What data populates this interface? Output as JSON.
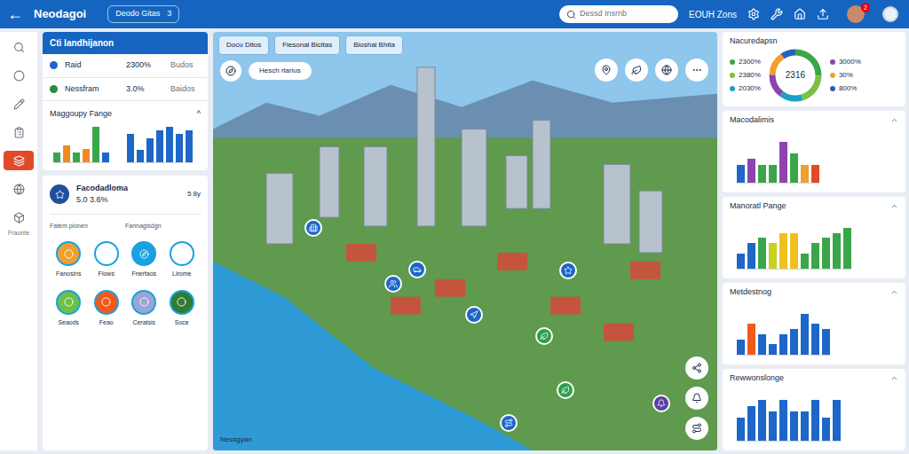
{
  "app": {
    "title": "Neodagoi",
    "back": "←"
  },
  "top_bar": {
    "pill": "Deodo Gitas",
    "pill_count": "3",
    "search": {
      "placeholder": "Dessd Insrnb"
    },
    "zone_label": "EOUH Zons",
    "badge": "2"
  },
  "rail": {
    "items": [
      {
        "selected": false
      },
      {
        "selected": false
      },
      {
        "selected": false
      },
      {
        "selected": false
      },
      {
        "selected": true
      },
      {
        "selected": false
      },
      {
        "selected": false
      }
    ],
    "caption": "Fraonte"
  },
  "left_panel": {
    "title": "Cti Iandhijanon",
    "stats": [
      {
        "name": "Raid",
        "value": "2300%",
        "note": "Budos",
        "color": "#1e66c8"
      },
      {
        "name": "Nessfram",
        "value": "3.0%",
        "note": "Baidos",
        "color": "#2e8b3e"
      }
    ],
    "chart": {
      "title": "Maggoupy Fange",
      "toggle": "^",
      "groups": [
        [
          {
            "value": 3,
            "color": "#3aa64a"
          },
          {
            "value": 5,
            "color": "#f08a24"
          },
          {
            "value": 3,
            "color": "#3aa64a"
          },
          {
            "value": 4,
            "color": "#f08a24"
          },
          {
            "value": 11,
            "color": "#3aa64a"
          },
          {
            "value": 3,
            "color": "#1e66c8"
          }
        ],
        [
          {
            "value": 7,
            "color": "#1e66c8"
          },
          {
            "value": 3,
            "color": "#1e66c8"
          },
          {
            "value": 6,
            "color": "#1e66c8"
          },
          {
            "value": 8,
            "color": "#1e66c8"
          },
          {
            "value": 9,
            "color": "#1e66c8"
          },
          {
            "value": 7,
            "color": "#1e66c8"
          },
          {
            "value": 8,
            "color": "#1e66c8"
          }
        ]
      ]
    },
    "card": {
      "title": "Facodadloma",
      "subtitle": "5.0 3.6%",
      "aside": "5 8y",
      "columns": [
        "Fatem pionen",
        "Fannagisdgn"
      ],
      "items": [
        {
          "label": "Fanosins",
          "color": "#f0a030"
        },
        {
          "label": "Flows",
          "color": "#ffffff"
        },
        {
          "label": "Fnerfaos",
          "color": "#1ba1e0"
        },
        {
          "label": "Lirome",
          "color": "#ffffff"
        },
        {
          "label": "Seaods",
          "color": "#6cc04a"
        },
        {
          "label": "Feao",
          "color": "#f05a1a"
        },
        {
          "label": "Ceratsis",
          "color": "#9aa6d6"
        },
        {
          "label": "Soce",
          "color": "#2e7d32"
        }
      ]
    }
  },
  "map": {
    "chips": [
      {
        "label": "Docu Ditos",
        "selected": false
      },
      {
        "label": "Fiesonal Bicitas",
        "selected": false
      },
      {
        "label": "Bioshal Bhita",
        "selected": false
      }
    ],
    "search_chip": "Hesch rlarius",
    "caption": "Nessgyan",
    "pins": [
      {
        "color": "#1e66c8"
      },
      {
        "color": "#1e66c8"
      },
      {
        "color": "#1e66c8"
      },
      {
        "color": "#1e66c8"
      },
      {
        "color": "#2e9e4f"
      },
      {
        "color": "#1e66c8"
      },
      {
        "color": "#2e9e4f"
      },
      {
        "color": "#5b3fa0"
      },
      {
        "color": "#1e66c8"
      }
    ]
  },
  "right_panel": {
    "donut": {
      "title": "Nacuredapsn",
      "center": "2316",
      "segments": [
        {
          "label": "2300%",
          "value": 25,
          "color": "#3aa64a"
        },
        {
          "label": "2380%",
          "value": 20,
          "color": "#7bc043"
        },
        {
          "label": "2030%",
          "value": 15,
          "color": "#1ba1c8"
        },
        {
          "label": "3000%",
          "value": 15,
          "color": "#8e44ad"
        },
        {
          "label": "30%",
          "value": 15,
          "color": "#f0a030"
        },
        {
          "label": "800%",
          "value": 10,
          "color": "#2b5fb3"
        }
      ]
    },
    "charts": [
      {
        "title": "Macodalimis",
        "bars": [
          {
            "value": 3,
            "color": "#1e66c8"
          },
          {
            "value": 4,
            "color": "#8e44ad"
          },
          {
            "value": 3,
            "color": "#3aa64a"
          },
          {
            "value": 3,
            "color": "#3aa64a"
          },
          {
            "value": 7,
            "color": "#8e44ad"
          },
          {
            "value": 5,
            "color": "#3aa64a"
          },
          {
            "value": 3,
            "color": "#f0a030"
          },
          {
            "value": 3,
            "color": "#e04a2a"
          }
        ]
      },
      {
        "title": "Manoratl Pange",
        "bars": [
          {
            "value": 3,
            "color": "#1e66c8"
          },
          {
            "value": 5,
            "color": "#1e66c8"
          },
          {
            "value": 6,
            "color": "#3aa64a"
          },
          {
            "value": 5,
            "color": "#c8d020"
          },
          {
            "value": 7,
            "color": "#f0c020"
          },
          {
            "value": 7,
            "color": "#f0c020"
          },
          {
            "value": 3,
            "color": "#3aa64a"
          },
          {
            "value": 5,
            "color": "#3aa64a"
          },
          {
            "value": 6,
            "color": "#3aa64a"
          },
          {
            "value": 7,
            "color": "#3aa64a"
          },
          {
            "value": 8,
            "color": "#3aa64a"
          }
        ]
      },
      {
        "title": "Metdestnog",
        "bars": [
          {
            "value": 3,
            "color": "#1e66c8"
          },
          {
            "value": 6,
            "color": "#f05a1a"
          },
          {
            "value": 4,
            "color": "#1e66c8"
          },
          {
            "value": 2,
            "color": "#1e66c8"
          },
          {
            "value": 4,
            "color": "#1e66c8"
          },
          {
            "value": 5,
            "color": "#1e66c8"
          },
          {
            "value": 8,
            "color": "#1e66c8"
          },
          {
            "value": 6,
            "color": "#1e66c8"
          },
          {
            "value": 5,
            "color": "#1e66c8"
          }
        ]
      },
      {
        "title": "Rewwonslonge",
        "bars": [
          {
            "value": 4,
            "color": "#1e66c8"
          },
          {
            "value": 6,
            "color": "#1e66c8"
          },
          {
            "value": 7,
            "color": "#1e66c8"
          },
          {
            "value": 5,
            "color": "#1e66c8"
          },
          {
            "value": 7,
            "color": "#1e66c8"
          },
          {
            "value": 5,
            "color": "#1e66c8"
          },
          {
            "value": 5,
            "color": "#1e66c8"
          },
          {
            "value": 7,
            "color": "#1e66c8"
          },
          {
            "value": 4,
            "color": "#1e66c8"
          },
          {
            "value": 7,
            "color": "#1e66c8"
          }
        ]
      }
    ]
  }
}
